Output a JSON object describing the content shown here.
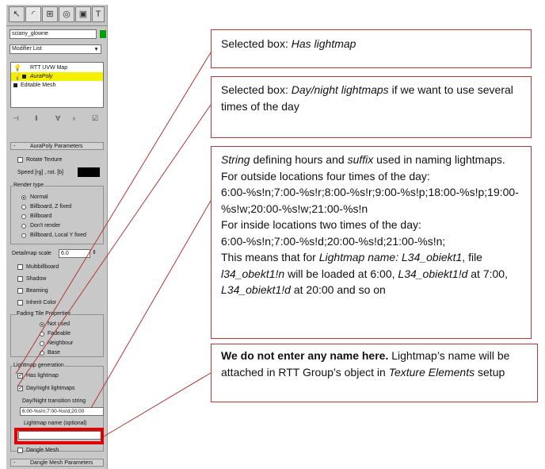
{
  "panel": {
    "object_name": "sciany_glowne",
    "modifier_list_label": "Modifier List",
    "stack_items": [
      "RTT UVW Map",
      "AuraPoly",
      "Editable Mesh"
    ],
    "aurapoly_params_title": "AuraPoly Parameters",
    "rotate_texture_label": "Rotate Texture",
    "speed_label": "Speed [rg] , rot. [b]",
    "render_type_title": "Render type",
    "render_types": [
      "Normal",
      "Billboard, Z fixed",
      "Billboard",
      "Don't render",
      "Billboard, Local Y fixed"
    ],
    "detailmap_scale_label": "Detailmap scale",
    "detailmap_scale_value": "6.0",
    "checks": [
      "Multibillboard",
      "Shadow",
      "Beaming",
      "Inherit Color"
    ],
    "fading_title": "Fading Tile Properties",
    "fading_options": [
      "Not used",
      "Fadeable",
      "Neighbour",
      "Base"
    ],
    "lightmap_title": "Lightmap generation",
    "has_lightmap_label": "Has lightmap",
    "daynight_label": "Day/night lightmaps",
    "transition_label": "Day/Night transition string",
    "transition_value": "6:00-%s!n;7:00-%s!d;20:00",
    "lightmap_name_label": "Lightmap name (optional)",
    "dangle_mesh_label": "Dangle Mesh",
    "dangle_params_title": "Dangle Mesh Parameters"
  },
  "notes": {
    "n1": {
      "a": "Selected box: ",
      "b": "Has lightmap"
    },
    "n2": {
      "a": "Selected box: ",
      "b": "Day/night lightmaps",
      "c": " if we want to use several times of the day"
    },
    "n3": {
      "l1a": "String",
      "l1b": " defining hours and ",
      "l1c": "suffix",
      "l1d": " used in naming lightmaps.",
      "l2": "For outside locations four times of the day:",
      "l3": "6:00-%s!n;7:00-%s!r;8:00-%s!r;9:00-%s!p;18:00-%s!p;19:00-%s!w;20:00-%s!w;21:00-%s!n",
      "l4": "For inside locations two times of the day:",
      "l5": "6:00-%s!n;7:00-%s!d;20:00-%s!d;21:00-%s!n;",
      "l6a": "This means that for ",
      "l6b": "Lightmap name: L34_obiekt1",
      "l6c": ", file ",
      "l6d": "l34_obekt1!n",
      "l6e": " will be loaded at 6:00, ",
      "l6f": "L34_obiekt1!d",
      "l6g": " at 7:00, ",
      "l6h": "L34_obiekt1!d",
      "l6i": " at 20:00 and so on"
    },
    "n4": {
      "a": "We do not enter any name here.",
      "b": " Lightmap’s name will be attached in RTT Group’s object in ",
      "c": "Texture Elements",
      "d": " setup"
    }
  }
}
